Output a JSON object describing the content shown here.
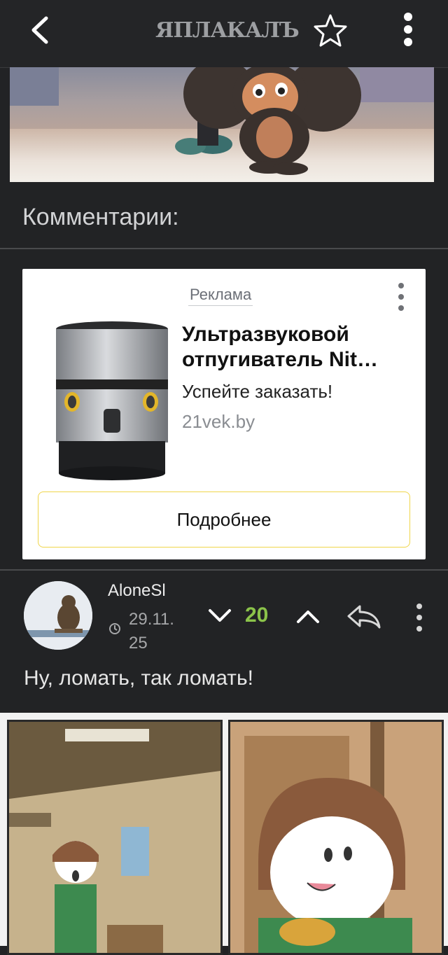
{
  "header": {
    "logo_text": "ЯПЛАКАЛЪ",
    "icons": [
      "chevron-left-icon",
      "star-icon",
      "more-vertical-icon"
    ]
  },
  "comments": {
    "title": "Комментарии:"
  },
  "ad": {
    "label": "Реклама",
    "title": "Ультразвуковой отпугиватель Nit…",
    "subtitle": "Успейте заказать!",
    "domain": "21vek.by",
    "button_label": "Подробнее",
    "accent_color": "#f0d64a"
  },
  "comment": {
    "username": "AloneSl",
    "date": "29.11. 25",
    "rating": "20",
    "rating_color": "#8bc34a",
    "text": "Ну, ломать, так ломать!"
  }
}
